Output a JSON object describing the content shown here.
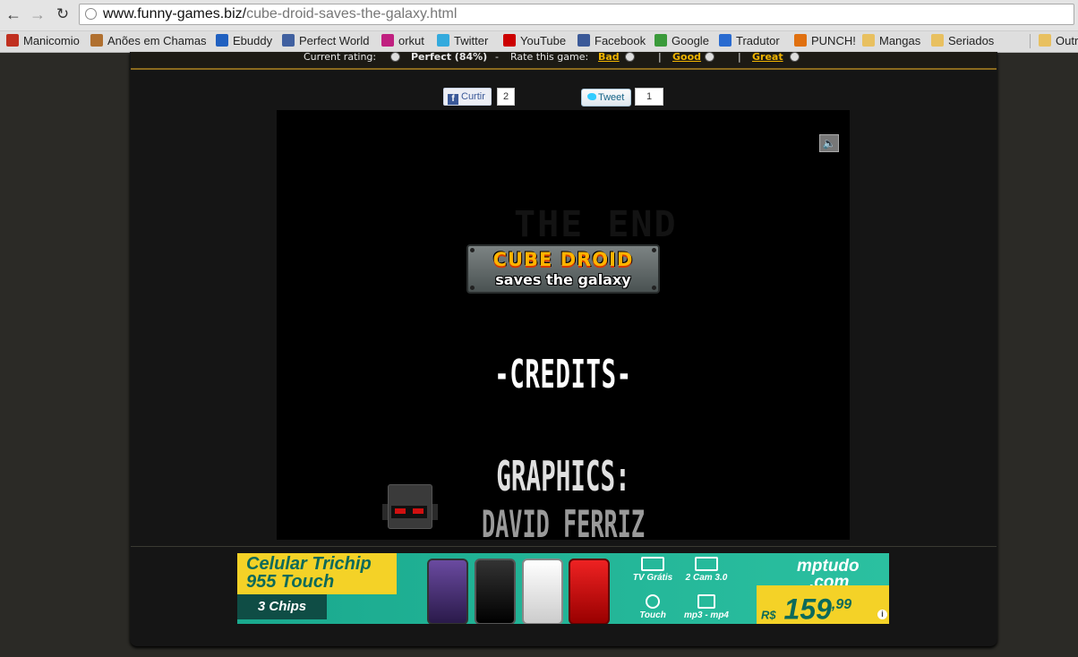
{
  "browser": {
    "url_host": "www.funny-games.biz/",
    "url_path": "cube-droid-saves-the-galaxy.html",
    "bookmarks": [
      {
        "label": "Manicomio",
        "color": "#c03020"
      },
      {
        "label": "Anões em Chamas",
        "color": "#b07030"
      },
      {
        "label": "Ebuddy",
        "color": "#2060c0"
      },
      {
        "label": "Perfect World",
        "color": "#4060a0"
      },
      {
        "label": "orkut",
        "color": "#c02080"
      },
      {
        "label": "Twitter",
        "color": "#33aadd"
      },
      {
        "label": "YouTube",
        "color": "#cc0000"
      },
      {
        "label": "Facebook",
        "color": "#3b5998"
      },
      {
        "label": "Google",
        "color": "#3a9a3a"
      },
      {
        "label": "Tradutor",
        "color": "#2a6bd0"
      },
      {
        "label": "PUNCH!",
        "color": "#e07010"
      },
      {
        "label": "Mangas",
        "color": "#e8c060"
      },
      {
        "label": "Seriados",
        "color": "#e8c060"
      },
      {
        "label": "Outr",
        "color": "#e8c060"
      }
    ]
  },
  "rating": {
    "current_label": "Current rating:",
    "current_value": "Perfect (84%)",
    "dash": "-",
    "rate_label": "Rate this game:",
    "bad": "Bad",
    "good": "Good",
    "great": "Great",
    "sep": "|"
  },
  "social": {
    "like_label": "Curtir",
    "like_count": "2",
    "tweet_label": "Tweet",
    "tweet_count": "1"
  },
  "game": {
    "faded_title": "THE END",
    "logo_top": "CUBE DROID",
    "logo_bottom": "saves the galaxy",
    "credits": "-CREDITS-",
    "graphics": "GRAPHICS:",
    "author": "DAVID FERRIZ",
    "sound_icon": "speaker-icon"
  },
  "ad": {
    "title_line1": "Celular Trichip",
    "title_line2": "955 Touch",
    "chips": "3 Chips",
    "feature_tv": "TV Grátis",
    "feature_cam": "2 Cam 3.0",
    "feature_touch": "Touch",
    "feature_mp3": "mp3 - mp4",
    "brand_line1": "mptudo",
    "brand_line2": ".com",
    "currency": "R$",
    "price": "159",
    "cents": ",99",
    "info": "i",
    "colors": {
      "bg": "#1aa98e",
      "yellow": "#f4d227",
      "dark": "#0c6a5a"
    }
  }
}
